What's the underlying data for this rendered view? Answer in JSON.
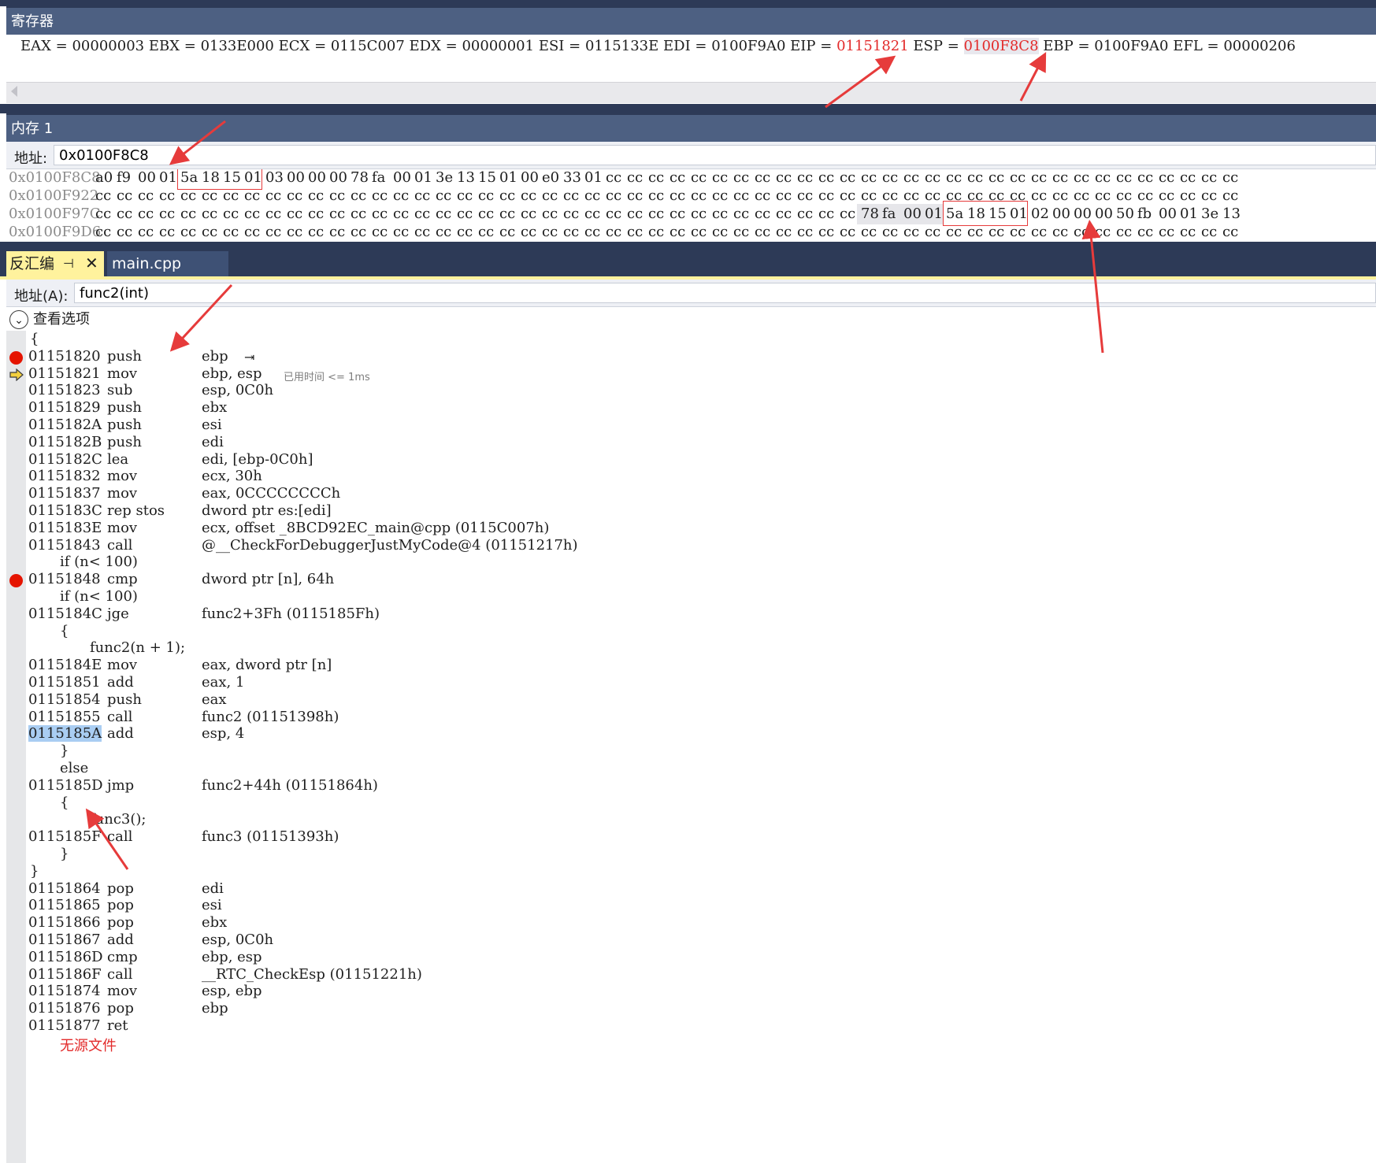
{
  "registers": {
    "title": "寄存器",
    "items": [
      {
        "name": "EAX",
        "value": "00000003"
      },
      {
        "name": "EBX",
        "value": "0133E000"
      },
      {
        "name": "ECX",
        "value": "0115C007"
      },
      {
        "name": "EDX",
        "value": "00000001"
      },
      {
        "name": "ESI",
        "value": "0115133E"
      },
      {
        "name": "EDI",
        "value": "0100F9A0"
      },
      {
        "name": "EIP",
        "value": "01151821"
      },
      {
        "name": "ESP",
        "value": "0100F8C8"
      },
      {
        "name": "EBP",
        "value": "0100F9A0"
      },
      {
        "name": "EFL",
        "value": "00000206"
      }
    ],
    "changed_color": "#e32b2b"
  },
  "memory": {
    "title": "内存 1",
    "address_label": "地址:",
    "address_value": "0x0100F8C8",
    "rows": [
      {
        "addr": "0x0100F8C8",
        "bytes": [
          "a0",
          "f9",
          "00",
          "01",
          "5a",
          "18",
          "15",
          "01",
          "03",
          "00",
          "00",
          "00",
          "78",
          "fa",
          "00",
          "01",
          "3e",
          "13",
          "15",
          "01",
          "00",
          "e0",
          "33",
          "01",
          "cc",
          "cc",
          "cc",
          "cc",
          "cc",
          "cc",
          "cc",
          "cc",
          "cc",
          "cc",
          "cc",
          "cc",
          "cc",
          "cc",
          "cc",
          "cc",
          "cc",
          "cc",
          "cc",
          "cc",
          "cc",
          "cc",
          "cc",
          "cc",
          "cc",
          "cc",
          "cc",
          "cc",
          "cc",
          "cc"
        ]
      },
      {
        "addr": "0x0100F922",
        "bytes": [
          "cc",
          "cc",
          "cc",
          "cc",
          "cc",
          "cc",
          "cc",
          "cc",
          "cc",
          "cc",
          "cc",
          "cc",
          "cc",
          "cc",
          "cc",
          "cc",
          "cc",
          "cc",
          "cc",
          "cc",
          "cc",
          "cc",
          "cc",
          "cc",
          "cc",
          "cc",
          "cc",
          "cc",
          "cc",
          "cc",
          "cc",
          "cc",
          "cc",
          "cc",
          "cc",
          "cc",
          "cc",
          "cc",
          "cc",
          "cc",
          "cc",
          "cc",
          "cc",
          "cc",
          "cc",
          "cc",
          "cc",
          "cc",
          "cc",
          "cc",
          "cc",
          "cc",
          "cc",
          "cc"
        ]
      },
      {
        "addr": "0x0100F97C",
        "bytes": [
          "cc",
          "cc",
          "cc",
          "cc",
          "cc",
          "cc",
          "cc",
          "cc",
          "cc",
          "cc",
          "cc",
          "cc",
          "cc",
          "cc",
          "cc",
          "cc",
          "cc",
          "cc",
          "cc",
          "cc",
          "cc",
          "cc",
          "cc",
          "cc",
          "cc",
          "cc",
          "cc",
          "cc",
          "cc",
          "cc",
          "cc",
          "cc",
          "cc",
          "cc",
          "cc",
          "cc",
          "78",
          "fa",
          "00",
          "01",
          "5a",
          "18",
          "15",
          "01",
          "02",
          "00",
          "00",
          "00",
          "50",
          "fb",
          "00",
          "01",
          "3e",
          "13"
        ]
      },
      {
        "addr": "0x0100F9D6",
        "bytes": [
          "cc",
          "cc",
          "cc",
          "cc",
          "cc",
          "cc",
          "cc",
          "cc",
          "cc",
          "cc",
          "cc",
          "cc",
          "cc",
          "cc",
          "cc",
          "cc",
          "cc",
          "cc",
          "cc",
          "cc",
          "cc",
          "cc",
          "cc",
          "cc",
          "cc",
          "cc",
          "cc",
          "cc",
          "cc",
          "cc",
          "cc",
          "cc",
          "cc",
          "cc",
          "cc",
          "cc",
          "cc",
          "cc",
          "cc",
          "cc",
          "cc",
          "cc",
          "cc",
          "cc",
          "cc",
          "cc",
          "cc",
          "cc",
          "cc",
          "cc",
          "cc",
          "cc",
          "cc",
          "cc"
        ]
      }
    ]
  },
  "tabs": [
    {
      "label": "反汇编",
      "active": true
    },
    {
      "label": "main.cpp",
      "active": false
    }
  ],
  "disasm": {
    "address_label": "地址(A):",
    "address_value": "func2(int)",
    "view_options": "查看选项",
    "elapsed_note": "已用时间 <= 1ms",
    "lines": [
      {
        "type": "src",
        "indent": 0,
        "text": "{"
      },
      {
        "type": "asm",
        "addr": "01151820",
        "mn": "push",
        "op": "ebp",
        "bp": true,
        "step": true
      },
      {
        "type": "asm",
        "addr": "01151821",
        "mn": "mov",
        "op": "ebp, esp",
        "ip": true,
        "note": true
      },
      {
        "type": "asm",
        "addr": "01151823",
        "mn": "sub",
        "op": "esp, 0C0h"
      },
      {
        "type": "asm",
        "addr": "01151829",
        "mn": "push",
        "op": "ebx"
      },
      {
        "type": "asm",
        "addr": "0115182A",
        "mn": "push",
        "op": "esi"
      },
      {
        "type": "asm",
        "addr": "0115182B",
        "mn": "push",
        "op": "edi"
      },
      {
        "type": "asm",
        "addr": "0115182C",
        "mn": "lea",
        "op": "edi, [ebp-0C0h]"
      },
      {
        "type": "asm",
        "addr": "01151832",
        "mn": "mov",
        "op": "ecx, 30h"
      },
      {
        "type": "asm",
        "addr": "01151837",
        "mn": "mov",
        "op": "eax, 0CCCCCCCCh"
      },
      {
        "type": "asm",
        "addr": "0115183C",
        "mn": "rep stos",
        "op": "dword ptr es:[edi]"
      },
      {
        "type": "asm",
        "addr": "0115183E",
        "mn": "mov",
        "op": "ecx, offset _8BCD92EC_main@cpp (0115C007h)"
      },
      {
        "type": "asm",
        "addr": "01151843",
        "mn": "call",
        "op": "@__CheckForDebuggerJustMyCode@4 (01151217h)"
      },
      {
        "type": "src",
        "indent": 1,
        "text": "if (n< 100)"
      },
      {
        "type": "asm",
        "addr": "01151848",
        "mn": "cmp",
        "op": "dword ptr [n], 64h",
        "bp": true
      },
      {
        "type": "src",
        "indent": 1,
        "text": "if (n< 100)"
      },
      {
        "type": "asm",
        "addr": "0115184C",
        "mn": "jge",
        "op": "func2+3Fh (0115185Fh)"
      },
      {
        "type": "src",
        "indent": 1,
        "text": "{"
      },
      {
        "type": "src",
        "indent": 2,
        "text": "func2(n + 1);"
      },
      {
        "type": "asm",
        "addr": "0115184E",
        "mn": "mov",
        "op": "eax, dword ptr [n]"
      },
      {
        "type": "asm",
        "addr": "01151851",
        "mn": "add",
        "op": "eax, 1"
      },
      {
        "type": "asm",
        "addr": "01151854",
        "mn": "push",
        "op": "eax"
      },
      {
        "type": "asm",
        "addr": "01151855",
        "mn": "call",
        "op": "func2 (01151398h)"
      },
      {
        "type": "asm",
        "addr": "0115185A",
        "mn": "add",
        "op": "esp, 4",
        "sel": true
      },
      {
        "type": "src",
        "indent": 1,
        "text": "}"
      },
      {
        "type": "src",
        "indent": 1,
        "text": "else"
      },
      {
        "type": "asm",
        "addr": "0115185D",
        "mn": "jmp",
        "op": "func2+44h (01151864h)"
      },
      {
        "type": "src",
        "indent": 1,
        "text": "{"
      },
      {
        "type": "src",
        "indent": 2,
        "text": "func3();"
      },
      {
        "type": "asm",
        "addr": "0115185F",
        "mn": "call",
        "op": "func3 (01151393h)"
      },
      {
        "type": "src",
        "indent": 1,
        "text": "}"
      },
      {
        "type": "src",
        "indent": 0,
        "text": "}"
      },
      {
        "type": "asm",
        "addr": "01151864",
        "mn": "pop",
        "op": "edi"
      },
      {
        "type": "asm",
        "addr": "01151865",
        "mn": "pop",
        "op": "esi"
      },
      {
        "type": "asm",
        "addr": "01151866",
        "mn": "pop",
        "op": "ebx"
      },
      {
        "type": "asm",
        "addr": "01151867",
        "mn": "add",
        "op": "esp, 0C0h"
      },
      {
        "type": "asm",
        "addr": "0115186D",
        "mn": "cmp",
        "op": "ebp, esp"
      },
      {
        "type": "asm",
        "addr": "0115186F",
        "mn": "call",
        "op": "__RTC_CheckEsp (01151221h)"
      },
      {
        "type": "asm",
        "addr": "01151874",
        "mn": "mov",
        "op": "esp, ebp"
      },
      {
        "type": "asm",
        "addr": "01151876",
        "mn": "pop",
        "op": "ebp"
      },
      {
        "type": "asm",
        "addr": "01151877",
        "mn": "ret",
        "op": ""
      }
    ],
    "bottom_text": "无源文件"
  },
  "icons": {
    "pin": "pin-icon",
    "close": "close-icon",
    "breakpoint": "breakpoint-icon",
    "instruction_pointer": "instruction-pointer-icon",
    "chevron": "chevron-down-icon",
    "step": "step-into-icon"
  },
  "colors": {
    "header": "#4d6082",
    "frame": "#2d3a57",
    "active_tab": "#fff29d",
    "breakpoint": "#e51400",
    "annotation": "#e63b3b"
  }
}
